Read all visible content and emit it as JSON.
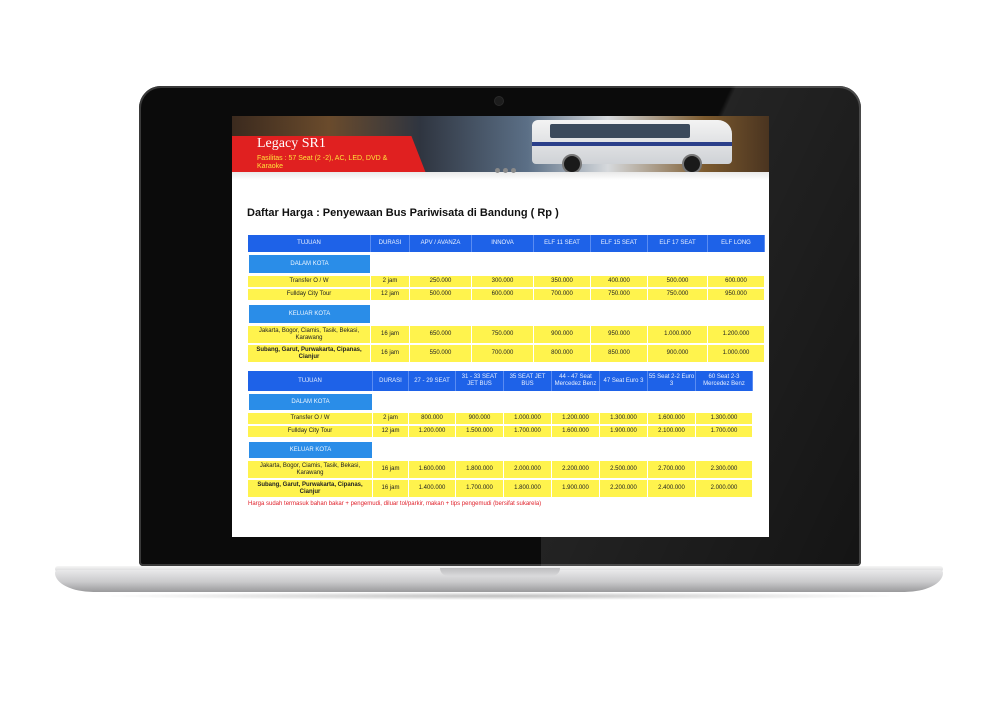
{
  "banner": {
    "title": "Legacy SR1",
    "subtitle": "Fasilitas : 57 Seat (2 -2), AC, LED, DVD & Karaoke"
  },
  "page": {
    "heading": "Daftar Harga : Penyewaan Bus Pariwisata di Bandung ( Rp )",
    "note": "Harga sudah termasuk bahan bakar + pengemudi, diluar tol/parkir, makan + tips pengemudi (bersifat sukarela)"
  },
  "table1": {
    "headers": [
      "TUJUAN",
      "DURASI",
      "APV / AVANZA",
      "INNOVA",
      "ELF 11 SEAT",
      "ELF 15 SEAT",
      "ELF 17 SEAT",
      "ELF LONG"
    ],
    "section_in": "DALAM KOTA",
    "section_out": "KELUAR KOTA",
    "rows_in": [
      {
        "dest": "Transfer O / W",
        "dur": "2 jam",
        "prices": [
          "250.000",
          "300.000",
          "350.000",
          "400.000",
          "500.000",
          "600.000"
        ]
      },
      {
        "dest": "Fullday City Tour",
        "dur": "12 jam",
        "prices": [
          "500.000",
          "600.000",
          "700.000",
          "750.000",
          "750.000",
          "950.000"
        ]
      }
    ],
    "rows_out": [
      {
        "dest": "Jakarta, Bogor, Ciamis, Tasik, Bekasi, Karawang",
        "dur": "16 jam",
        "prices": [
          "650.000",
          "750.000",
          "900.000",
          "950.000",
          "1.000.000",
          "1.200.000"
        ]
      },
      {
        "dest": "Subang, Garut, Purwakarta, Cipanas, Cianjur",
        "dur": "16 jam",
        "prices": [
          "550.000",
          "700.000",
          "800.000",
          "850.000",
          "900.000",
          "1.000.000"
        ]
      }
    ]
  },
  "table2": {
    "headers": [
      "TUJUAN",
      "DURASI",
      "27 - 29 SEAT",
      "31 - 33 SEAT JET BUS",
      "35 SEAT JET BUS",
      "44 - 47 Seat Mercedez Benz",
      "47 Seat Euro 3",
      "55 Seat 2-2 Euro 3",
      "60 Seat 2-3 Mercedez Benz"
    ],
    "section_in": "DALAM KOTA",
    "section_out": "KELUAR KOTA",
    "rows_in": [
      {
        "dest": "Transfer O / W",
        "dur": "2 jam",
        "prices": [
          "800.000",
          "900.000",
          "1.000.000",
          "1.200.000",
          "1.300.000",
          "1.600.000",
          "1.300.000"
        ]
      },
      {
        "dest": "Fullday City Tour",
        "dur": "12 jam",
        "prices": [
          "1.200.000",
          "1.500.000",
          "1.700.000",
          "1.600.000",
          "1.900.000",
          "2.100.000",
          "1.700.000"
        ]
      }
    ],
    "rows_out": [
      {
        "dest": "Jakarta, Bogor, Ciamis, Tasik, Bekasi, Karawang",
        "dur": "16 jam",
        "prices": [
          "1.600.000",
          "1.800.000",
          "2.000.000",
          "2.200.000",
          "2.500.000",
          "2.700.000",
          "2.300.000"
        ]
      },
      {
        "dest": "Subang, Garut, Purwakarta, Cipanas, Cianjur",
        "dur": "16 jam",
        "prices": [
          "1.400.000",
          "1.700.000",
          "1.800.000",
          "1.900.000",
          "2.200.000",
          "2.400.000",
          "2.000.000"
        ]
      }
    ]
  }
}
